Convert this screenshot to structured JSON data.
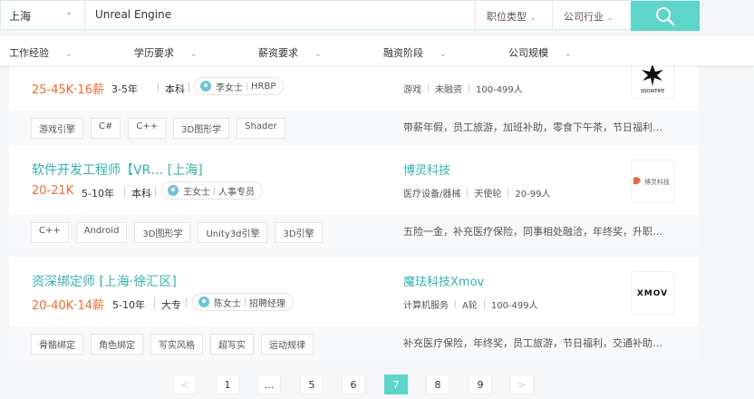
{
  "search": {
    "city": "上海",
    "query": "Unreal Engine",
    "filters": [
      "职位类型",
      "公司行业"
    ]
  },
  "conditions": [
    "工作经验",
    "学历要求",
    "薪资要求",
    "融资阶段",
    "公司规模"
  ],
  "jobs": [
    {
      "title": "",
      "salary": "25-45K·16薪",
      "experience": "3-5年",
      "education": "本科",
      "recruiter_name": "李女士",
      "recruiter_role": "HRBP",
      "company": "",
      "industry": "游戏",
      "funding": "未融资",
      "size": "100-499人",
      "logo_text": "SNOWPIPE",
      "tags": [
        "游戏引擎",
        "C#",
        "C++",
        "3D图形学",
        "Shader"
      ],
      "welfare": "带薪年假，员工旅游，加班补助，零食下午茶，节日福利…"
    },
    {
      "title": "软件开发工程师【VR…  [上海]",
      "salary": "20-21K",
      "experience": "5-10年",
      "education": "本科",
      "recruiter_name": "王女士",
      "recruiter_role": "人事专员",
      "company": "博灵科技",
      "industry": "医疗设备/器械",
      "funding": "天使轮",
      "size": "20-99人",
      "logo_text": "博灵科技",
      "tags": [
        "C++",
        "Android",
        "3D图形学",
        "Unity3d引擎",
        "3D引擎"
      ],
      "welfare": "五险一金，补充医疗保险，同事相处融洽，年终奖，升职…"
    },
    {
      "title": "资深绑定师  [上海·徐汇区]",
      "salary": "20-40K·14薪",
      "experience": "5-10年",
      "education": "大专",
      "recruiter_name": "陈女士",
      "recruiter_role": "招聘经理",
      "company": "魔珐科技Xmov",
      "industry": "计算机服务",
      "funding": "A轮",
      "size": "100-499人",
      "logo_text": "XMOV",
      "tags": [
        "骨骼绑定",
        "角色绑定",
        "写实风格",
        "超写实",
        "运动规律"
      ],
      "welfare": "补充医疗保险，年终奖，员工旅游，节日福利，交通补助…"
    }
  ],
  "pagination": {
    "prev": "<",
    "pages": [
      "1",
      "...",
      "5",
      "6",
      "7",
      "8",
      "9"
    ],
    "current": "7",
    "next": ">"
  },
  "colors": {
    "accent": "#5dd5c8",
    "link": "#34b3a8",
    "salary": "#f26d2f"
  }
}
